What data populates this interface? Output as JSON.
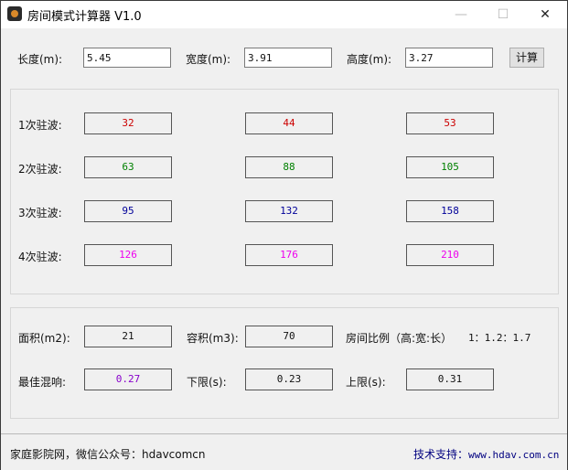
{
  "window": {
    "title": "房间模式计算器  V1.0",
    "icon": "speaker-icon",
    "controls": {
      "minimize": "—",
      "maximize": "☐",
      "close": "✕"
    }
  },
  "inputs": {
    "length_label": "长度(m):",
    "length_value": "5.45",
    "width_label": "宽度(m):",
    "width_value": "3.91",
    "height_label": "高度(m):",
    "height_value": "3.27",
    "calculate_button": "计算"
  },
  "modes": {
    "rows": [
      {
        "label": "1次驻波:",
        "values": [
          "32",
          "44",
          "53"
        ],
        "color": "#cc0000"
      },
      {
        "label": "2次驻波:",
        "values": [
          "63",
          "88",
          "105"
        ],
        "color": "#008000"
      },
      {
        "label": "3次驻波:",
        "values": [
          "95",
          "132",
          "158"
        ],
        "color": "#000099"
      },
      {
        "label": "4次驻波:",
        "values": [
          "126",
          "176",
          "210"
        ],
        "color": "#ee00ee"
      }
    ]
  },
  "results": {
    "area_label": "面积(m2):",
    "area_value": "21",
    "volume_label": "容积(m3):",
    "volume_value": "70",
    "ratio_label": "房间比例（高:宽:长）",
    "ratio_value": "1：1.2：1.7",
    "rt_label": "最佳混响:",
    "rt_value": "0.27",
    "rt_color": "#8800cc",
    "lower_label": "下限(s):",
    "lower_value": "0.23",
    "upper_label": "上限(s):",
    "upper_value": "0.31"
  },
  "footer": {
    "left_text": "家庭影院网，微信公众号：hdavcomcn",
    "support_label": "技术支持：",
    "support_url": "www.hdav.com.cn",
    "link_color": "#000080"
  }
}
